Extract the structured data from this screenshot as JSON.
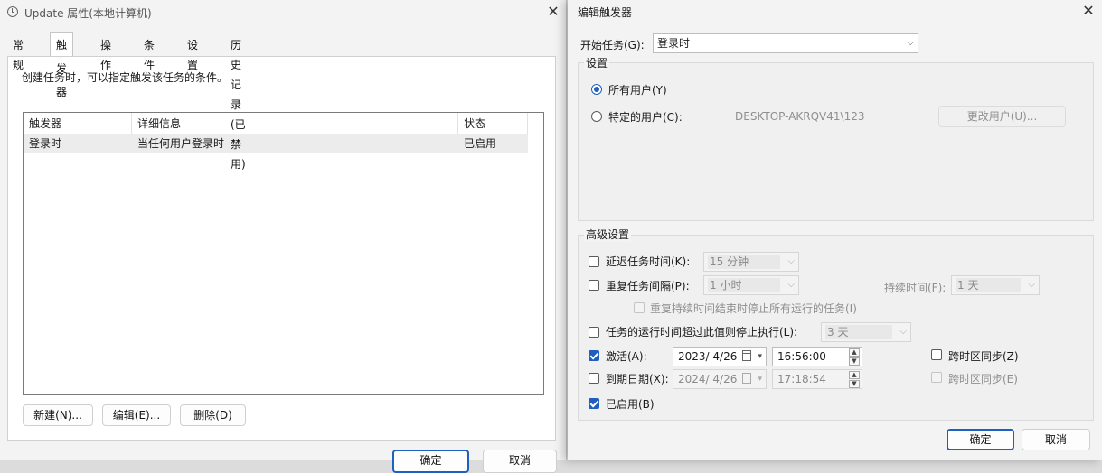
{
  "back_window": {
    "title": "Update 属性(本地计算机)",
    "tabs": [
      "常规",
      "触发器",
      "操作",
      "条件",
      "设置",
      "历史记录(已禁用)"
    ],
    "active_tab": 1,
    "description": "创建任务时，可以指定触发该任务的条件。",
    "columns": [
      "触发器",
      "详细信息",
      "状态"
    ],
    "rows": [
      {
        "trigger": "登录时",
        "details": "当任何用户登录时",
        "status": "已启用"
      }
    ],
    "buttons": {
      "new": "新建(N)...",
      "edit": "编辑(E)...",
      "delete": "删除(D)"
    },
    "footer_buttons": {
      "ok": "确定",
      "cancel": "取消"
    }
  },
  "dialog": {
    "title": "编辑触发器",
    "begin_task_label": "开始任务(G):",
    "begin_task_value": "登录时",
    "settings_group": "设置",
    "all_users_label": "所有用户(Y)",
    "specific_user_label": "特定的用户(C):",
    "specific_user_value": "DESKTOP-AKRQV41\\123",
    "change_user_button": "更改用户(U)...",
    "advanced_group": "高级设置",
    "delay_label": "延迟任务时间(K):",
    "delay_value": "15 分钟",
    "repeat_label": "重复任务间隔(P):",
    "repeat_value": "1 小时",
    "duration_label": "持续时间(F):",
    "duration_value": "1 天",
    "stop_all_label": "重复持续时间结束时停止所有运行的任务(I)",
    "stop_if_longer_label": "任务的运行时间超过此值则停止执行(L):",
    "stop_if_longer_value": "3 天",
    "activate_label": "激活(A):",
    "activate_date": "2023/  4/26",
    "activate_time": "16:56:00",
    "sync_tz_label": "跨时区同步(Z)",
    "expire_label": "到期日期(X):",
    "expire_date": "2024/  4/26",
    "expire_time": "17:18:54",
    "sync_tz_expire_label": "跨时区同步(E)",
    "enabled_label": "已启用(B)",
    "ok_button": "确定",
    "cancel_button": "取消",
    "state": {
      "all_users": true,
      "delay": false,
      "repeat": false,
      "stop_all": false,
      "stop_if_longer": false,
      "activate": true,
      "sync_tz": false,
      "expire": false,
      "sync_tz_expire": false,
      "enabled": true
    }
  },
  "colors": {
    "accent": "#1f5fbf",
    "window_bg": "#f3f3f3"
  }
}
